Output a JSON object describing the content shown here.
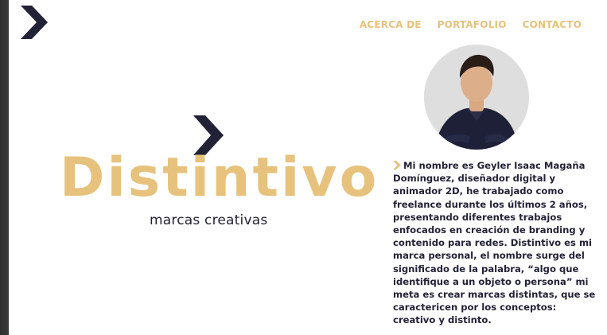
{
  "nav": {
    "items": [
      {
        "label": "ACERCA DE"
      },
      {
        "label": "PORTAFOLIO"
      },
      {
        "label": "CONTACTO"
      }
    ]
  },
  "hero": {
    "brand": "Distintivo",
    "tagline": "marcas creativas"
  },
  "about": {
    "text": "Mi nombre es Geyler Isaac Magaña Domínguez, diseñador digital y animador 2D, he trabajado como freelance durante los últimos 2 años, presentando diferentes trabajos enfocados en creación de branding y contenido para redes. Distintivo es mi marca personal, el nombre surge del significado de la palabra, “algo que identifique a un objeto o persona” mi meta es crear marcas distintas, que se caractericen por los conceptos: creativo y distinto."
  },
  "colors": {
    "accent": "#e6c27d",
    "navy": "#222236",
    "background": "#ffffff"
  },
  "icons": {
    "logo": "chevron-logo-icon",
    "hero": "chevron-icon",
    "bio": "small-chevron-icon"
  }
}
